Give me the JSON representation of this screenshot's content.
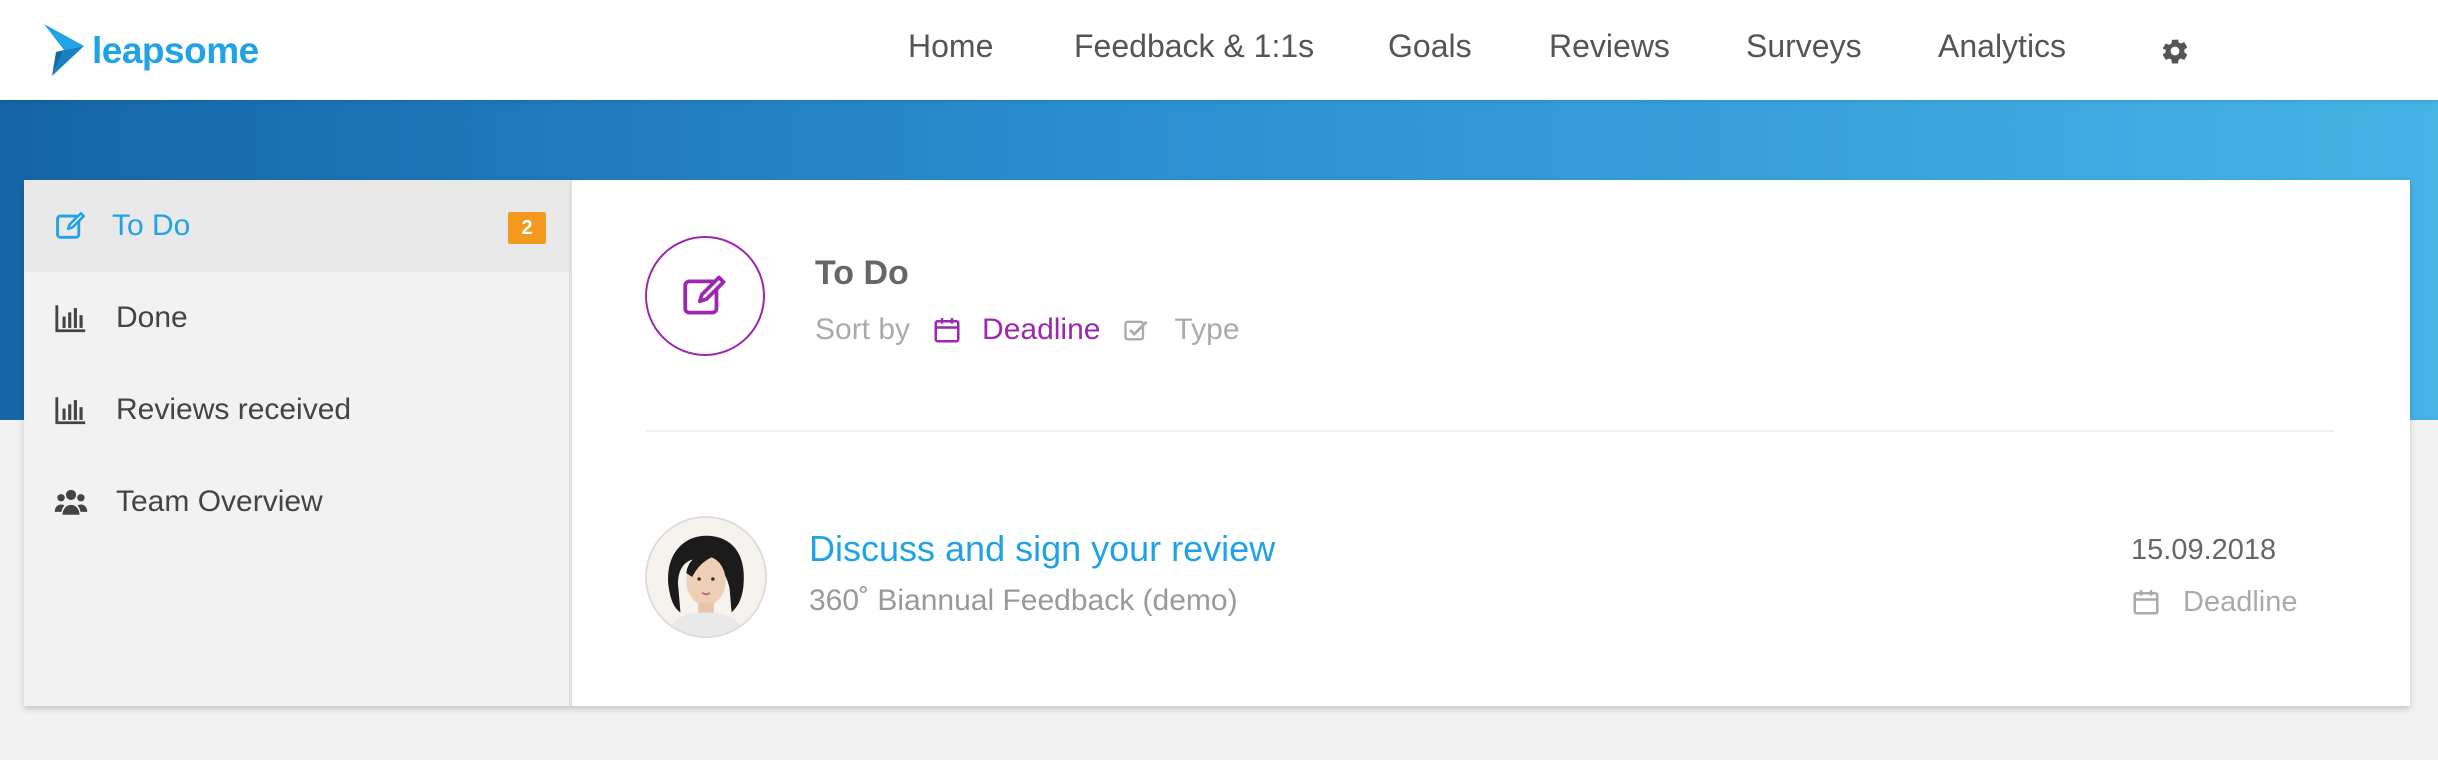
{
  "brand": {
    "name": "leapsome",
    "color": "#1fa3e6"
  },
  "nav": {
    "items": [
      {
        "label": "Home"
      },
      {
        "label": "Feedback & 1:1s"
      },
      {
        "label": "Goals"
      },
      {
        "label": "Reviews"
      },
      {
        "label": "Surveys"
      },
      {
        "label": "Analytics"
      }
    ],
    "settings_icon": "gear-icon"
  },
  "sidebar": {
    "items": [
      {
        "label": "To Do",
        "icon": "edit-icon",
        "active": true,
        "badge": "2"
      },
      {
        "label": "Done",
        "icon": "bar-chart-icon"
      },
      {
        "label": "Reviews received",
        "icon": "bar-chart-icon"
      },
      {
        "label": "Team Overview",
        "icon": "users-icon"
      }
    ]
  },
  "main": {
    "title": "To Do",
    "sort_label": "Sort by",
    "sort_options": [
      {
        "label": "Deadline",
        "icon": "calendar-icon",
        "active": true
      },
      {
        "label": "Type",
        "icon": "checkbox-icon",
        "active": false
      }
    ],
    "tasks": [
      {
        "title": "Discuss and sign your review",
        "subtitle": "360˚ Biannual Feedback (demo)",
        "date": "15.09.2018",
        "date_label": "Deadline"
      }
    ]
  },
  "colors": {
    "accent": "#1fa3e6",
    "purple": "#9c27b0",
    "badge": "#f39a1e",
    "band_start": "#1565a6",
    "band_end": "#45b3e6"
  }
}
